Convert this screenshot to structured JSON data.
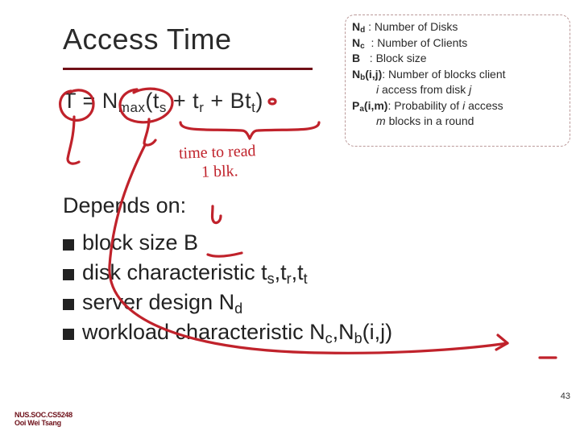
{
  "title": "Access Time",
  "legend": {
    "nd": {
      "sym": "N",
      "sub": "d",
      "text": ": Number of Disks"
    },
    "nc": {
      "sym": "N",
      "sub": "c",
      "text": ": Number of Clients"
    },
    "b": {
      "sym": "B",
      "sub": "",
      "text": ": Block size"
    },
    "nb": {
      "sym": "N",
      "sub": "b",
      "arg": "(i,j)",
      "text": ": Number of blocks client",
      "cont": "access from disk",
      "ivar": "i",
      "jvar": "j"
    },
    "pa": {
      "sym": "P",
      "sub": "a",
      "arg": "(i,m)",
      "text": ": Probability of",
      "ivar": "i",
      "text2": "access",
      "cont": "blocks in a round",
      "mvar": "m"
    }
  },
  "equation": {
    "lhs": "T = N",
    "nmax_sub": "max",
    "after_nmax": "(t",
    "ts_sub": "s",
    "plus1": " + t",
    "tr_sub": "r",
    "plus2": " + Bt",
    "tt_sub": "t",
    "close": ")"
  },
  "depends_label": "Depends on:",
  "bullets": {
    "b1": {
      "pre": "block size B"
    },
    "b2": {
      "pre": "disk characteristic t",
      "s1": "s",
      "mid1": ",t",
      "s2": "r",
      "mid2": ",t",
      "s3": "t"
    },
    "b3": {
      "pre": "server design N",
      "s1": "d"
    },
    "b4": {
      "pre": "workload characteristic N",
      "s1": "c",
      "mid1": ",N",
      "s2": "b",
      "tail": "(i,j)"
    }
  },
  "handwriting": {
    "line1": "time to read",
    "line2": "1 blk."
  },
  "page_number": "43",
  "footer_line1": "NUS.SOC.CS5248",
  "footer_line2": "Ooi Wei Tsang"
}
